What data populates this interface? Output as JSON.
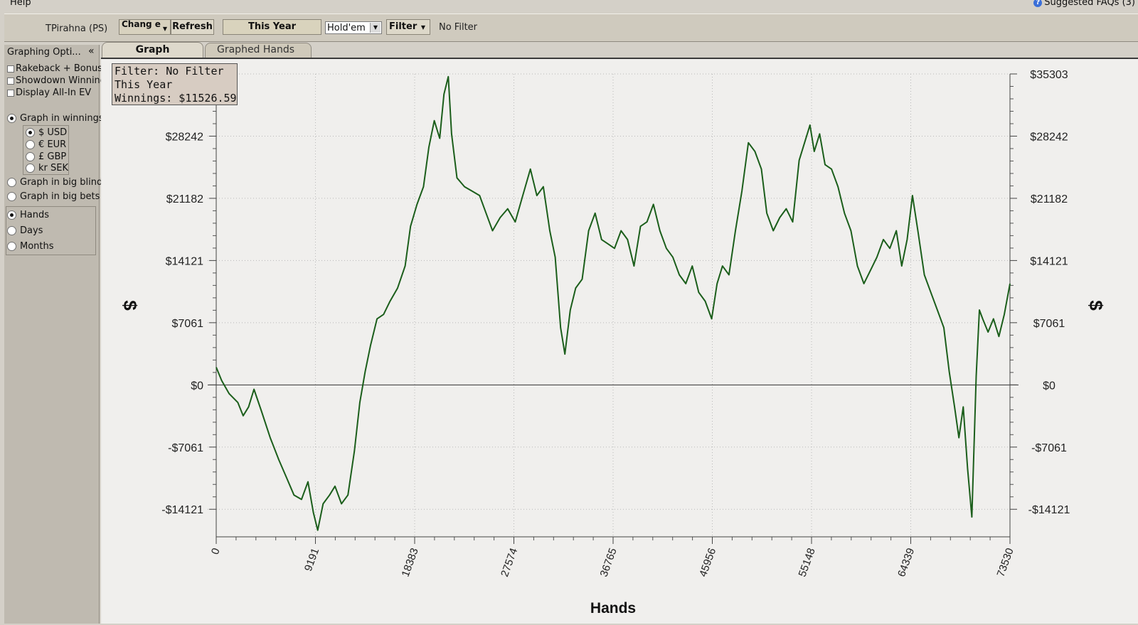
{
  "menu": {
    "help": "Help",
    "faq": "Suggested FAQs (3)"
  },
  "toolbar": {
    "player": "TPirahna (PS)",
    "change_label": "Chang e",
    "refresh_label": "Refresh",
    "date_range": "This Year",
    "game_type": "Hold'em",
    "filter_label": "Filter",
    "filter_status": "No Filter"
  },
  "sidebar": {
    "title": "Graphing Opti...",
    "collapse": "«",
    "checkboxes": [
      {
        "label": "Rakeback + Bonus",
        "checked": false
      },
      {
        "label": "Showdown Winnings",
        "checked": false
      },
      {
        "label": "Display All-In EV",
        "checked": false
      }
    ],
    "graph_in_winnings": "Graph in winnings",
    "currencies": [
      {
        "label": "$ USD",
        "selected": true
      },
      {
        "label": "€ EUR",
        "selected": false
      },
      {
        "label": "£ GBP",
        "selected": false
      },
      {
        "label": "kr SEK",
        "selected": false
      }
    ],
    "graph_in_big_blinds": "Graph in big blinds",
    "graph_in_big_bets": "Graph in big bets",
    "x_axis_options": [
      {
        "label": "Hands",
        "selected": true
      },
      {
        "label": "Days",
        "selected": false
      },
      {
        "label": "Months",
        "selected": false
      }
    ]
  },
  "tabs": {
    "graph": "Graph",
    "graphed_hands": "Graphed Hands"
  },
  "tooltip": {
    "line1": "Filter: No Filter",
    "line2": "This Year",
    "line3": "Winnings: $11526.59"
  },
  "colors": {
    "line": "#1b5e1b",
    "plot_bg": "#f0efed",
    "grid": "#b8b8b8"
  },
  "chart_data": {
    "type": "line",
    "xlabel": "Hands",
    "ylabel": "$",
    "xlim": [
      0,
      73530
    ],
    "ylim": [
      -17250,
      35303
    ],
    "x_ticks": [
      0,
      9191,
      18383,
      27574,
      36765,
      45956,
      55148,
      64339,
      73530
    ],
    "x_tick_labels": [
      "0",
      "9191",
      "18383",
      "27574",
      "36765",
      "45956",
      "55148",
      "64339",
      "73530"
    ],
    "y_ticks": [
      -14121,
      -7061,
      0,
      7061,
      14121,
      21182,
      28242,
      35303
    ],
    "y_tick_labels": [
      "-$14121",
      "-$7061",
      "$0",
      "$7061",
      "$14121",
      "$21182",
      "$28242",
      "$35303"
    ],
    "grid": true,
    "series": [
      {
        "values": [
          [
            0,
            2000
          ],
          [
            500,
            500
          ],
          [
            1200,
            -1000
          ],
          [
            2000,
            -2000
          ],
          [
            2500,
            -3500
          ],
          [
            3000,
            -2500
          ],
          [
            3500,
            -500
          ],
          [
            4200,
            -3000
          ],
          [
            5000,
            -6000
          ],
          [
            5800,
            -8500
          ],
          [
            6500,
            -10500
          ],
          [
            7200,
            -12500
          ],
          [
            7900,
            -13000
          ],
          [
            8500,
            -11000
          ],
          [
            9000,
            -14500
          ],
          [
            9400,
            -16500
          ],
          [
            9900,
            -13500
          ],
          [
            10500,
            -12500
          ],
          [
            11000,
            -11500
          ],
          [
            11600,
            -13500
          ],
          [
            12200,
            -12500
          ],
          [
            12800,
            -7500
          ],
          [
            13300,
            -2000
          ],
          [
            13800,
            1500
          ],
          [
            14300,
            4500
          ],
          [
            14900,
            7500
          ],
          [
            15500,
            8000
          ],
          [
            16100,
            9500
          ],
          [
            16800,
            11000
          ],
          [
            17500,
            13500
          ],
          [
            18000,
            18000
          ],
          [
            18600,
            20500
          ],
          [
            19200,
            22500
          ],
          [
            19700,
            27000
          ],
          [
            20200,
            30000
          ],
          [
            20700,
            28000
          ],
          [
            21100,
            33000
          ],
          [
            21500,
            35000
          ],
          [
            21800,
            28500
          ],
          [
            22300,
            23500
          ],
          [
            23000,
            22500
          ],
          [
            23700,
            22000
          ],
          [
            24400,
            21500
          ],
          [
            25000,
            19500
          ],
          [
            25600,
            17500
          ],
          [
            26300,
            19000
          ],
          [
            27000,
            20000
          ],
          [
            27700,
            18500
          ],
          [
            28400,
            21500
          ],
          [
            29100,
            24500
          ],
          [
            29700,
            21500
          ],
          [
            30300,
            22500
          ],
          [
            30900,
            17500
          ],
          [
            31400,
            14500
          ],
          [
            31900,
            6500
          ],
          [
            32300,
            3500
          ],
          [
            32800,
            8500
          ],
          [
            33300,
            11000
          ],
          [
            33900,
            12000
          ],
          [
            34500,
            17500
          ],
          [
            35100,
            19500
          ],
          [
            35700,
            16500
          ],
          [
            36300,
            16000
          ],
          [
            36900,
            15500
          ],
          [
            37500,
            17500
          ],
          [
            38100,
            16500
          ],
          [
            38700,
            13500
          ],
          [
            39300,
            18000
          ],
          [
            39900,
            18500
          ],
          [
            40500,
            20500
          ],
          [
            41100,
            17500
          ],
          [
            41700,
            15500
          ],
          [
            42300,
            14500
          ],
          [
            42900,
            12500
          ],
          [
            43500,
            11500
          ],
          [
            44100,
            13500
          ],
          [
            44700,
            10500
          ],
          [
            45300,
            9500
          ],
          [
            45900,
            7500
          ],
          [
            46400,
            11500
          ],
          [
            46900,
            13500
          ],
          [
            47500,
            12500
          ],
          [
            48100,
            17500
          ],
          [
            48700,
            22000
          ],
          [
            49300,
            27500
          ],
          [
            49900,
            26500
          ],
          [
            50500,
            24500
          ],
          [
            51000,
            19500
          ],
          [
            51600,
            17500
          ],
          [
            52200,
            19000
          ],
          [
            52800,
            20000
          ],
          [
            53400,
            18500
          ],
          [
            54000,
            25500
          ],
          [
            54500,
            27500
          ],
          [
            55000,
            29500
          ],
          [
            55400,
            26500
          ],
          [
            55900,
            28500
          ],
          [
            56400,
            25000
          ],
          [
            57000,
            24500
          ],
          [
            57600,
            22500
          ],
          [
            58200,
            19500
          ],
          [
            58800,
            17500
          ],
          [
            59400,
            13500
          ],
          [
            60000,
            11500
          ],
          [
            60600,
            13000
          ],
          [
            61200,
            14500
          ],
          [
            61800,
            16500
          ],
          [
            62400,
            15500
          ],
          [
            63000,
            17500
          ],
          [
            63500,
            13500
          ],
          [
            64000,
            16500
          ],
          [
            64500,
            21500
          ],
          [
            65000,
            17500
          ],
          [
            65600,
            12500
          ],
          [
            66200,
            10500
          ],
          [
            66800,
            8500
          ],
          [
            67400,
            6500
          ],
          [
            67900,
            1500
          ],
          [
            68400,
            -2500
          ],
          [
            68800,
            -6000
          ],
          [
            69200,
            -2500
          ],
          [
            69600,
            -9500
          ],
          [
            70000,
            -15000
          ],
          [
            70400,
            1000
          ],
          [
            70700,
            8500
          ],
          [
            71000,
            7500
          ],
          [
            71500,
            6000
          ],
          [
            72000,
            7500
          ],
          [
            72500,
            5500
          ],
          [
            73000,
            8000
          ],
          [
            73530,
            11500
          ]
        ]
      }
    ]
  }
}
